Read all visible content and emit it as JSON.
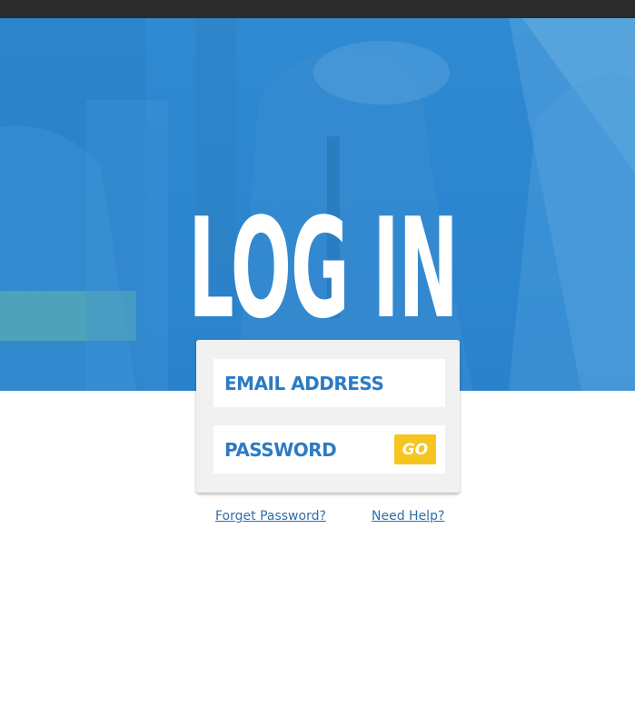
{
  "page": {
    "title": "LOG IN"
  },
  "form": {
    "email_placeholder": "EMAIL ADDRESS",
    "password_placeholder": "PASSWORD",
    "go_label": "GO"
  },
  "links": {
    "forgot": "Forget Password?",
    "help": "Need Help?"
  },
  "colors": {
    "hero_blue": "#2c86cf",
    "field_text": "#2c7bc4",
    "go_button": "#f6c51f",
    "link": "#2f6ea8",
    "top_bar": "#2b2b2b"
  }
}
